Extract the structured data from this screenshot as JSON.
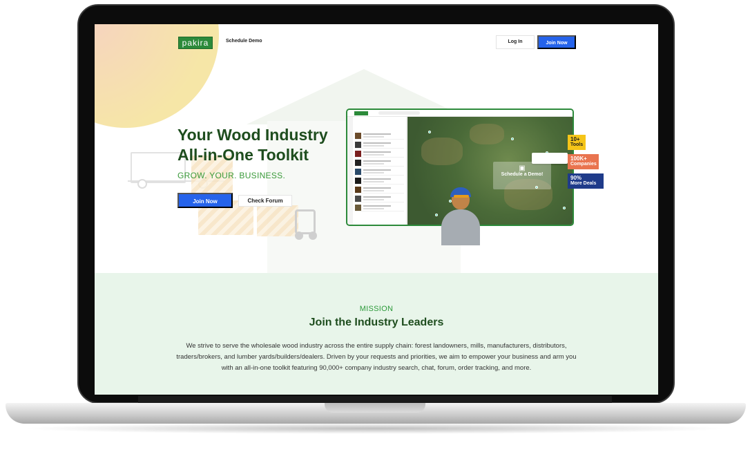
{
  "nav": {
    "logo": "pakira",
    "schedule_demo": "Schedule Demo",
    "login": "Log In",
    "join": "Join Now"
  },
  "hero": {
    "title_line1": "Your Wood Industry",
    "title_line2": "All-in-One Toolkit",
    "subtitle": "GROW. YOUR. BUSINESS.",
    "join_button": "Join Now",
    "forum_button": "Check Forum"
  },
  "mockup": {
    "demo_cta": "Schedule a Demo!",
    "demo_icon": "calendar-icon"
  },
  "badges": {
    "tools_value": "10+",
    "tools_label": "Tools",
    "companies_value": "100K+",
    "companies_label": "Companies",
    "deals_value": "90%",
    "deals_label": "More Deals"
  },
  "mission": {
    "label": "MISSION",
    "title": "Join the Industry Leaders",
    "body": "We strive to serve the wholesale wood industry across the entire supply chain: forest landowners, mills, manufacturers, distributors, traders/brokers, and lumber yards/builders/dealers. Driven by your requests and priorities, we aim to empower your business and arm you with an all-in-one toolkit featuring 90,000+ company industry search, chat, forum, order tracking, and more."
  },
  "colors": {
    "brand_green": "#2c8a3a",
    "heading_green": "#1e4d1e",
    "primary_blue": "#2563eb",
    "mission_bg": "#e8f5ea"
  }
}
